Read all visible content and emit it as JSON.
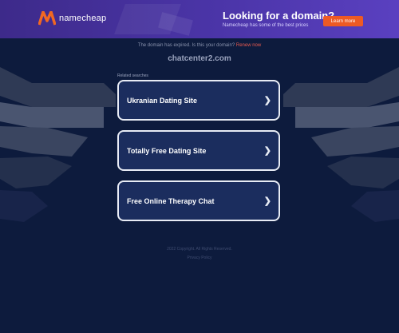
{
  "banner": {
    "logo_text": "namecheap",
    "promo_title": "Looking for a domain?",
    "promo_subtitle": "Namecheap has some of the best prices",
    "learn_more": "Learn more"
  },
  "notice": {
    "text": "The domain has expired. Is this your domain?",
    "link": "Renew now"
  },
  "domain_name": "chatcenter2.com",
  "related_label": "Related searches",
  "links": [
    {
      "label": "Ukranian Dating Site"
    },
    {
      "label": "Totally Free Dating Site"
    },
    {
      "label": "Free Online Therapy Chat"
    }
  ],
  "footer": {
    "copyright": "2022 Copyright. All Rights Reserved.",
    "privacy": "Privacy Policy"
  },
  "colors": {
    "background": "#0d1b3d",
    "banner": "#4b35a8",
    "accent": "#ee5a24",
    "link_box": "#1b2d5e"
  }
}
